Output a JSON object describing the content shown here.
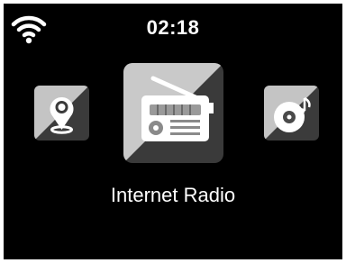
{
  "status_bar": {
    "wifi_icon": "wifi-icon",
    "time": "02:18"
  },
  "menu": {
    "items": [
      {
        "icon": "location-pin-icon",
        "selected": false
      },
      {
        "icon": "radio-icon",
        "selected": true
      },
      {
        "icon": "music-disc-icon",
        "selected": false
      }
    ],
    "selected_label": "Internet Radio"
  },
  "colors": {
    "background": "#000000",
    "tile_light": "#c8c8c8",
    "tile_dark": "#3a3a3a",
    "foreground": "#ffffff"
  }
}
